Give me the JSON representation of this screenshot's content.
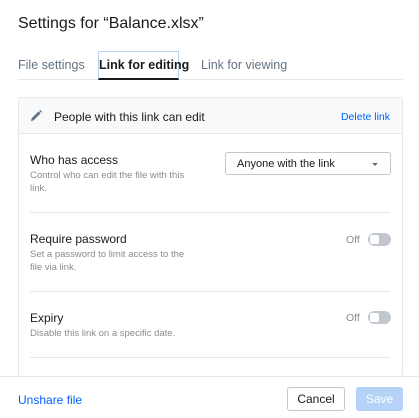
{
  "dialog": {
    "title": "Settings for “Balance.xlsx”"
  },
  "tabs": [
    {
      "label": "File settings",
      "active": false
    },
    {
      "label": "Link for editing",
      "active": true
    },
    {
      "label": "Link for viewing",
      "active": false
    }
  ],
  "panel": {
    "header_text": "People with this link can edit",
    "header_icon": "pencil-icon",
    "delete_link": "Delete link",
    "access": {
      "title": "Who has access",
      "description": "Control who can edit the file with this link.",
      "selected": "Anyone with the link"
    },
    "password": {
      "title": "Require password",
      "description": "Set a password to limit access to the file via link.",
      "state": "Off"
    },
    "expiry": {
      "title": "Expiry",
      "description": "Disable this link on a specific date.",
      "state": "Off"
    }
  },
  "footer": {
    "unshare_label": "Unshare file",
    "cancel_label": "Cancel",
    "save_label": "Save"
  },
  "colors": {
    "link": "#0061fe",
    "save_disabled": "#b5d3f7",
    "active_tab_border": "#b8d3f3"
  }
}
